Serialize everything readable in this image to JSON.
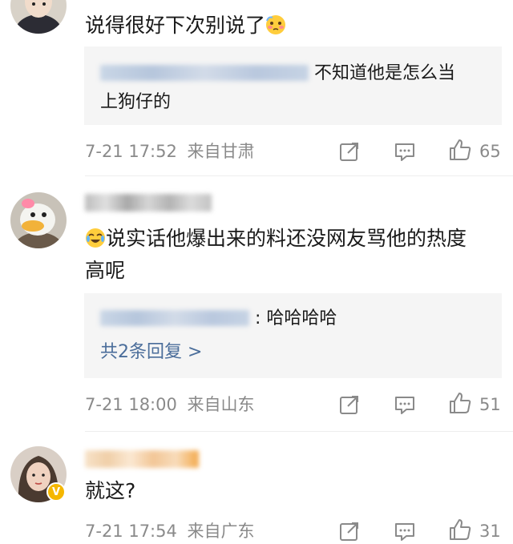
{
  "comments": [
    {
      "text": "说得很好下次别说了",
      "reply": {
        "text_line1": "不知道他是怎么当",
        "text_line2": "上狗仔的"
      },
      "date": "7-21 17:52",
      "location": "来自甘肃",
      "likes": "65"
    },
    {
      "text_line1": "说实话他爆出来的料还没网友骂他的热度",
      "text_line2": "高呢",
      "reply": {
        "text": ": 哈哈哈哈",
        "more": "共2条回复 >"
      },
      "date": "7-21 18:00",
      "location": "来自山东",
      "likes": "51"
    },
    {
      "text": "就这?",
      "badge": "V",
      "date": "7-21 17:54",
      "location": "来自广东",
      "likes": "31"
    }
  ],
  "icons": {
    "share": "share-icon",
    "comment": "comment-icon",
    "like": "thumbs-up-icon",
    "emoji_shy": "blushing-face-icon",
    "emoji_cry": "crying-laughing-icon"
  },
  "colors": {
    "link": "#4a6d9a",
    "meta": "#8a8a8a",
    "reply_bg": "#f5f5f5",
    "badge": "#f5b700"
  }
}
